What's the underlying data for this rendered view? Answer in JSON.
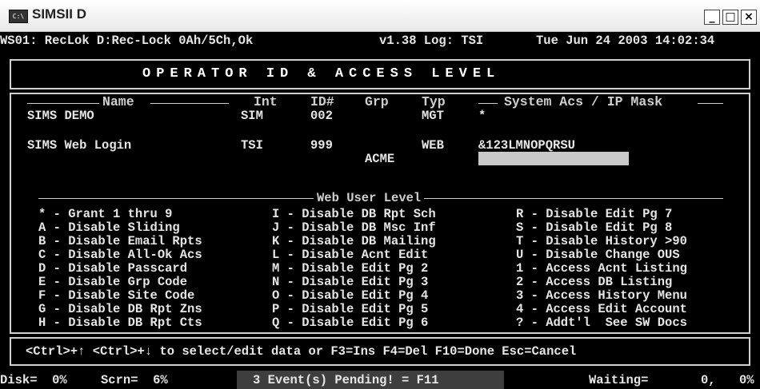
{
  "window": {
    "title": "SIMSII D",
    "icon": "console-icon",
    "buttons": {
      "minimize": "_",
      "maximize": "□",
      "close": "×"
    }
  },
  "status_top": {
    "left": "WS01: RecLok D:Rec-Lock 0Ah/5Ch,Ok",
    "version": "v1.38 Log: TSI",
    "datetime": "Tue Jun 24 2003 14:02:34"
  },
  "banner": "OPERATOR ID & ACCESS LEVEL",
  "columns": {
    "name": "Name",
    "int": "Int",
    "id": "ID#",
    "grp": "Grp",
    "typ": "Typ",
    "sys": "System Acs / IP Mask"
  },
  "rows": [
    {
      "name": "SIMS DEMO",
      "int": "SIM",
      "id": "002",
      "grp": "",
      "typ": "MGT",
      "sys": "*"
    },
    {
      "name": "SIMS Web Login",
      "int": "TSI",
      "id": "999",
      "grp": "ACME",
      "typ": "WEB",
      "sys": "&123LMNOPQRSU"
    }
  ],
  "web_user_level": {
    "title": "Web User Level",
    "col1": [
      "* - Grant 1 thru 9",
      "A - Disable Sliding",
      "B - Disable Email Rpts",
      "C - Disable All-Ok Acs",
      "D - Disable Passcard",
      "E - Disable Grp Code",
      "F - Disable Site Code",
      "G - Disable DB Rpt Zns",
      "H - Disable DB Rpt Cts"
    ],
    "col2": [
      "I - Disable DB Rpt Sch",
      "J - Disable DB Msc Inf",
      "K - Disable DB Mailing",
      "L - Disable Acnt Edit",
      "M - Disable Edit Pg 2",
      "N - Disable Edit Pg 3",
      "O - Disable Edit Pg 4",
      "P - Disable Edit Pg 5",
      "Q - Disable Edit Pg 6"
    ],
    "col3": [
      "R - Disable Edit Pg 7",
      "S - Disable Edit Pg 8",
      "T - Disable History >90",
      "U - Disable Change OUS",
      "1 - Access Acnt Listing",
      "2 - Access DB Listing",
      "3 - Access History Menu",
      "4 - Access Edit Account",
      "? - Addt'l  See SW Docs"
    ]
  },
  "help_line": "<Ctrl>+↑ <Ctrl>+↓ to select/edit data or F3=Ins F4=Del F10=Done Esc=Cancel",
  "status_bottom": {
    "disk": "Disk=  0%",
    "scrn": "Scrn=  6%",
    "events": "3 Event(s) Pending! = F11",
    "waiting": "Waiting=",
    "waiting_val": "0,",
    "pct": "0%"
  },
  "colors": {
    "background": "#000000",
    "text": "#e6e6e6",
    "input_bar": "#c9c9c9",
    "status_segment": "#3e3e3e"
  }
}
